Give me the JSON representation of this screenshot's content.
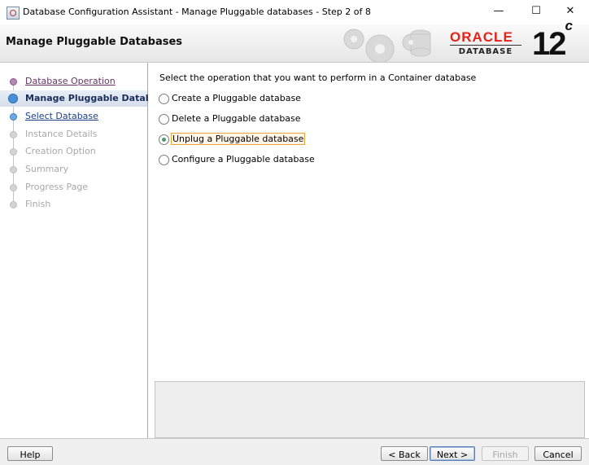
{
  "window": {
    "title": "Database Configuration Assistant - Manage Pluggable databases - Step 2 of 8",
    "minimize_glyph": "—",
    "maximize_glyph": "☐",
    "close_glyph": "✕"
  },
  "header": {
    "title": "Manage Pluggable Databases",
    "logo_word": "ORACLE",
    "logo_sub": "DATABASE",
    "version": "12",
    "version_suffix": "c"
  },
  "steps": [
    {
      "label": "Database Operation",
      "state": "visited"
    },
    {
      "label": "Manage Pluggable Databases",
      "state": "active"
    },
    {
      "label": "Select Database",
      "state": "clickable"
    },
    {
      "label": "Instance Details",
      "state": "disabled"
    },
    {
      "label": "Creation Option",
      "state": "disabled"
    },
    {
      "label": "Summary",
      "state": "disabled"
    },
    {
      "label": "Progress Page",
      "state": "disabled"
    },
    {
      "label": "Finish",
      "state": "disabled"
    }
  ],
  "content": {
    "prompt": "Select the operation that you want to perform in a Container database",
    "options": [
      {
        "label": "Create a Pluggable database",
        "checked": false
      },
      {
        "label": "Delete a Pluggable database",
        "checked": false
      },
      {
        "label": "Unplug a Pluggable database",
        "checked": true
      },
      {
        "label": "Configure a Pluggable database",
        "checked": false
      }
    ]
  },
  "buttons": {
    "help": "Help",
    "back": "< Back",
    "next": "Next >",
    "finish": "Finish",
    "cancel": "Cancel"
  },
  "colors": {
    "oracle_red": "#e2231a",
    "active_step_bg": "#dde5f0",
    "selected_radio": "#4c9a6a"
  }
}
